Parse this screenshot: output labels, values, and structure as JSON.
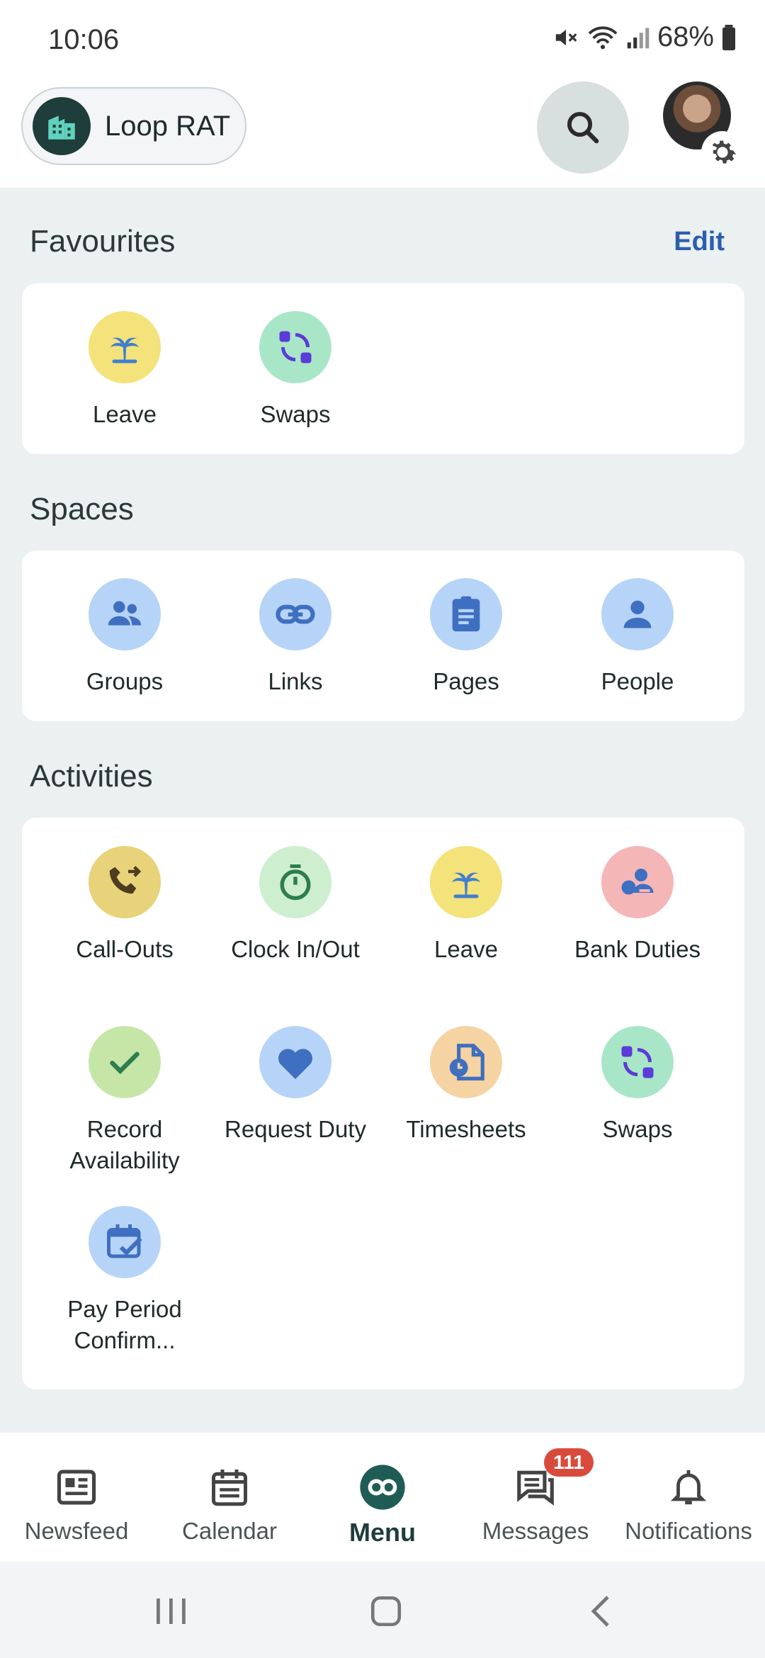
{
  "status_bar": {
    "time": "10:06",
    "battery": "68%"
  },
  "header": {
    "org_name": "Loop RAT"
  },
  "favourites": {
    "title": "Favourites",
    "edit_label": "Edit",
    "items": [
      {
        "label": "Leave",
        "icon": "palm-tree-icon",
        "color": "#f4e27a"
      },
      {
        "label": "Swaps",
        "icon": "swap-icon",
        "color": "#a9e6c8"
      }
    ]
  },
  "spaces": {
    "title": "Spaces",
    "items": [
      {
        "label": "Groups",
        "icon": "groups-icon",
        "color": "#b6d4f7"
      },
      {
        "label": "Links",
        "icon": "link-icon",
        "color": "#b6d4f7"
      },
      {
        "label": "Pages",
        "icon": "clipboard-icon",
        "color": "#b6d4f7"
      },
      {
        "label": "People",
        "icon": "person-icon",
        "color": "#b6d4f7"
      }
    ]
  },
  "activities": {
    "title": "Activities",
    "items": [
      {
        "label": "Call-Outs",
        "icon": "phone-forward-icon",
        "color": "#e8d27a"
      },
      {
        "label": "Clock In/Out",
        "icon": "stopwatch-icon",
        "color": "#cdeecf"
      },
      {
        "label": "Leave",
        "icon": "palm-tree-icon",
        "color": "#f4e27a"
      },
      {
        "label": "Bank Duties",
        "icon": "bank-duties-icon",
        "color": "#f5b6b8"
      },
      {
        "label": "Record Availability",
        "icon": "check-icon",
        "color": "#c6e6a8"
      },
      {
        "label": "Request Duty",
        "icon": "heart-icon",
        "color": "#b6d4f7"
      },
      {
        "label": "Timesheets",
        "icon": "timesheet-icon",
        "color": "#f6d3a3"
      },
      {
        "label": "Swaps",
        "icon": "swap-icon",
        "color": "#a9e6c8"
      },
      {
        "label": "Pay Period Confirm...",
        "icon": "calendar-check-icon",
        "color": "#b6d4f7"
      }
    ]
  },
  "bottom_nav": {
    "items": [
      {
        "label": "Newsfeed",
        "icon": "newsfeed-icon"
      },
      {
        "label": "Calendar",
        "icon": "calendar-icon"
      },
      {
        "label": "Menu",
        "icon": "menu-loop-icon"
      },
      {
        "label": "Messages",
        "icon": "messages-icon",
        "badge": "111"
      },
      {
        "label": "Notifications",
        "icon": "bell-icon"
      }
    ]
  }
}
